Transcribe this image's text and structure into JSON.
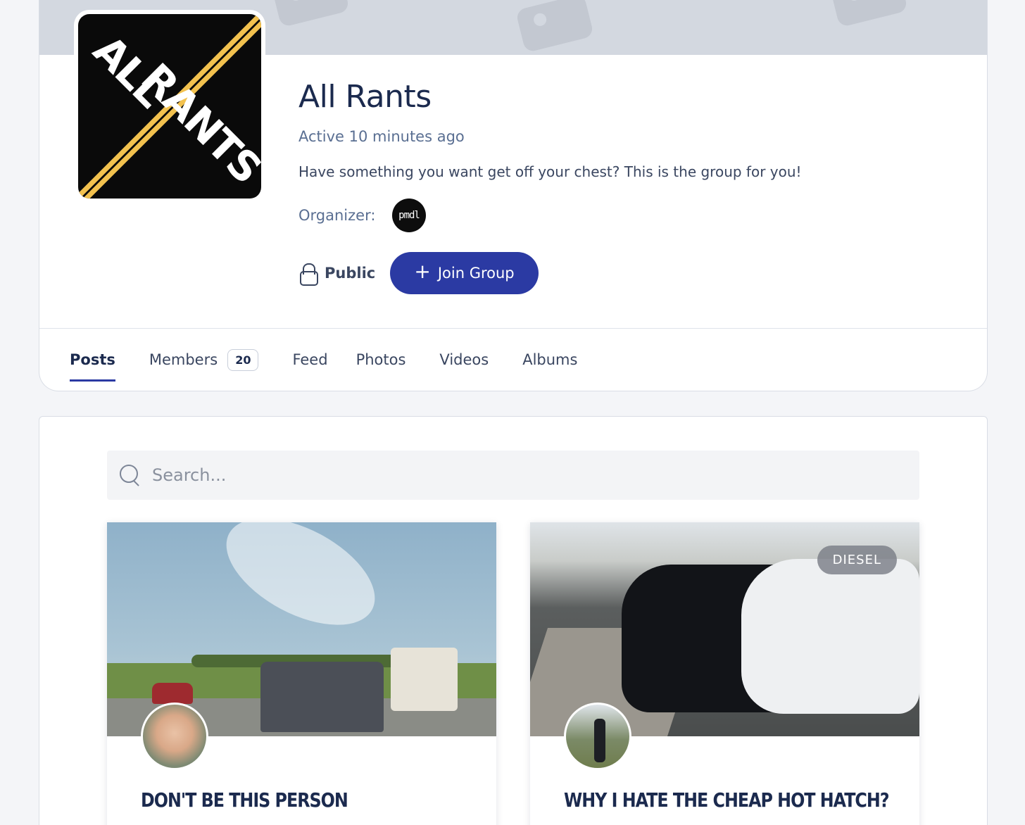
{
  "group": {
    "title": "All Rants",
    "avatar_lines": [
      "ALL",
      "RANTS"
    ],
    "active": "Active 10 minutes ago",
    "description": "Have something you want get off your chest? This is the group for you!",
    "organizer_label": "Organizer:",
    "organizer_avatar_text": "pmdl",
    "privacy": "Public",
    "join_label": "Join Group",
    "colors": {
      "accent": "#2b3aa3",
      "stripe": "#f2c14e"
    }
  },
  "tabs": [
    {
      "label": "Posts",
      "active": true
    },
    {
      "label": "Members",
      "badge": "20"
    },
    {
      "label": "Feed"
    },
    {
      "label": "Photos"
    },
    {
      "label": "Videos"
    },
    {
      "label": "Albums"
    }
  ],
  "search": {
    "placeholder": "Search..."
  },
  "posts": [
    {
      "title": "DON'T BE THIS PERSON"
    },
    {
      "title": "WHY I HATE THE CHEAP HOT HATCH?",
      "category": "DIESEL"
    }
  ]
}
